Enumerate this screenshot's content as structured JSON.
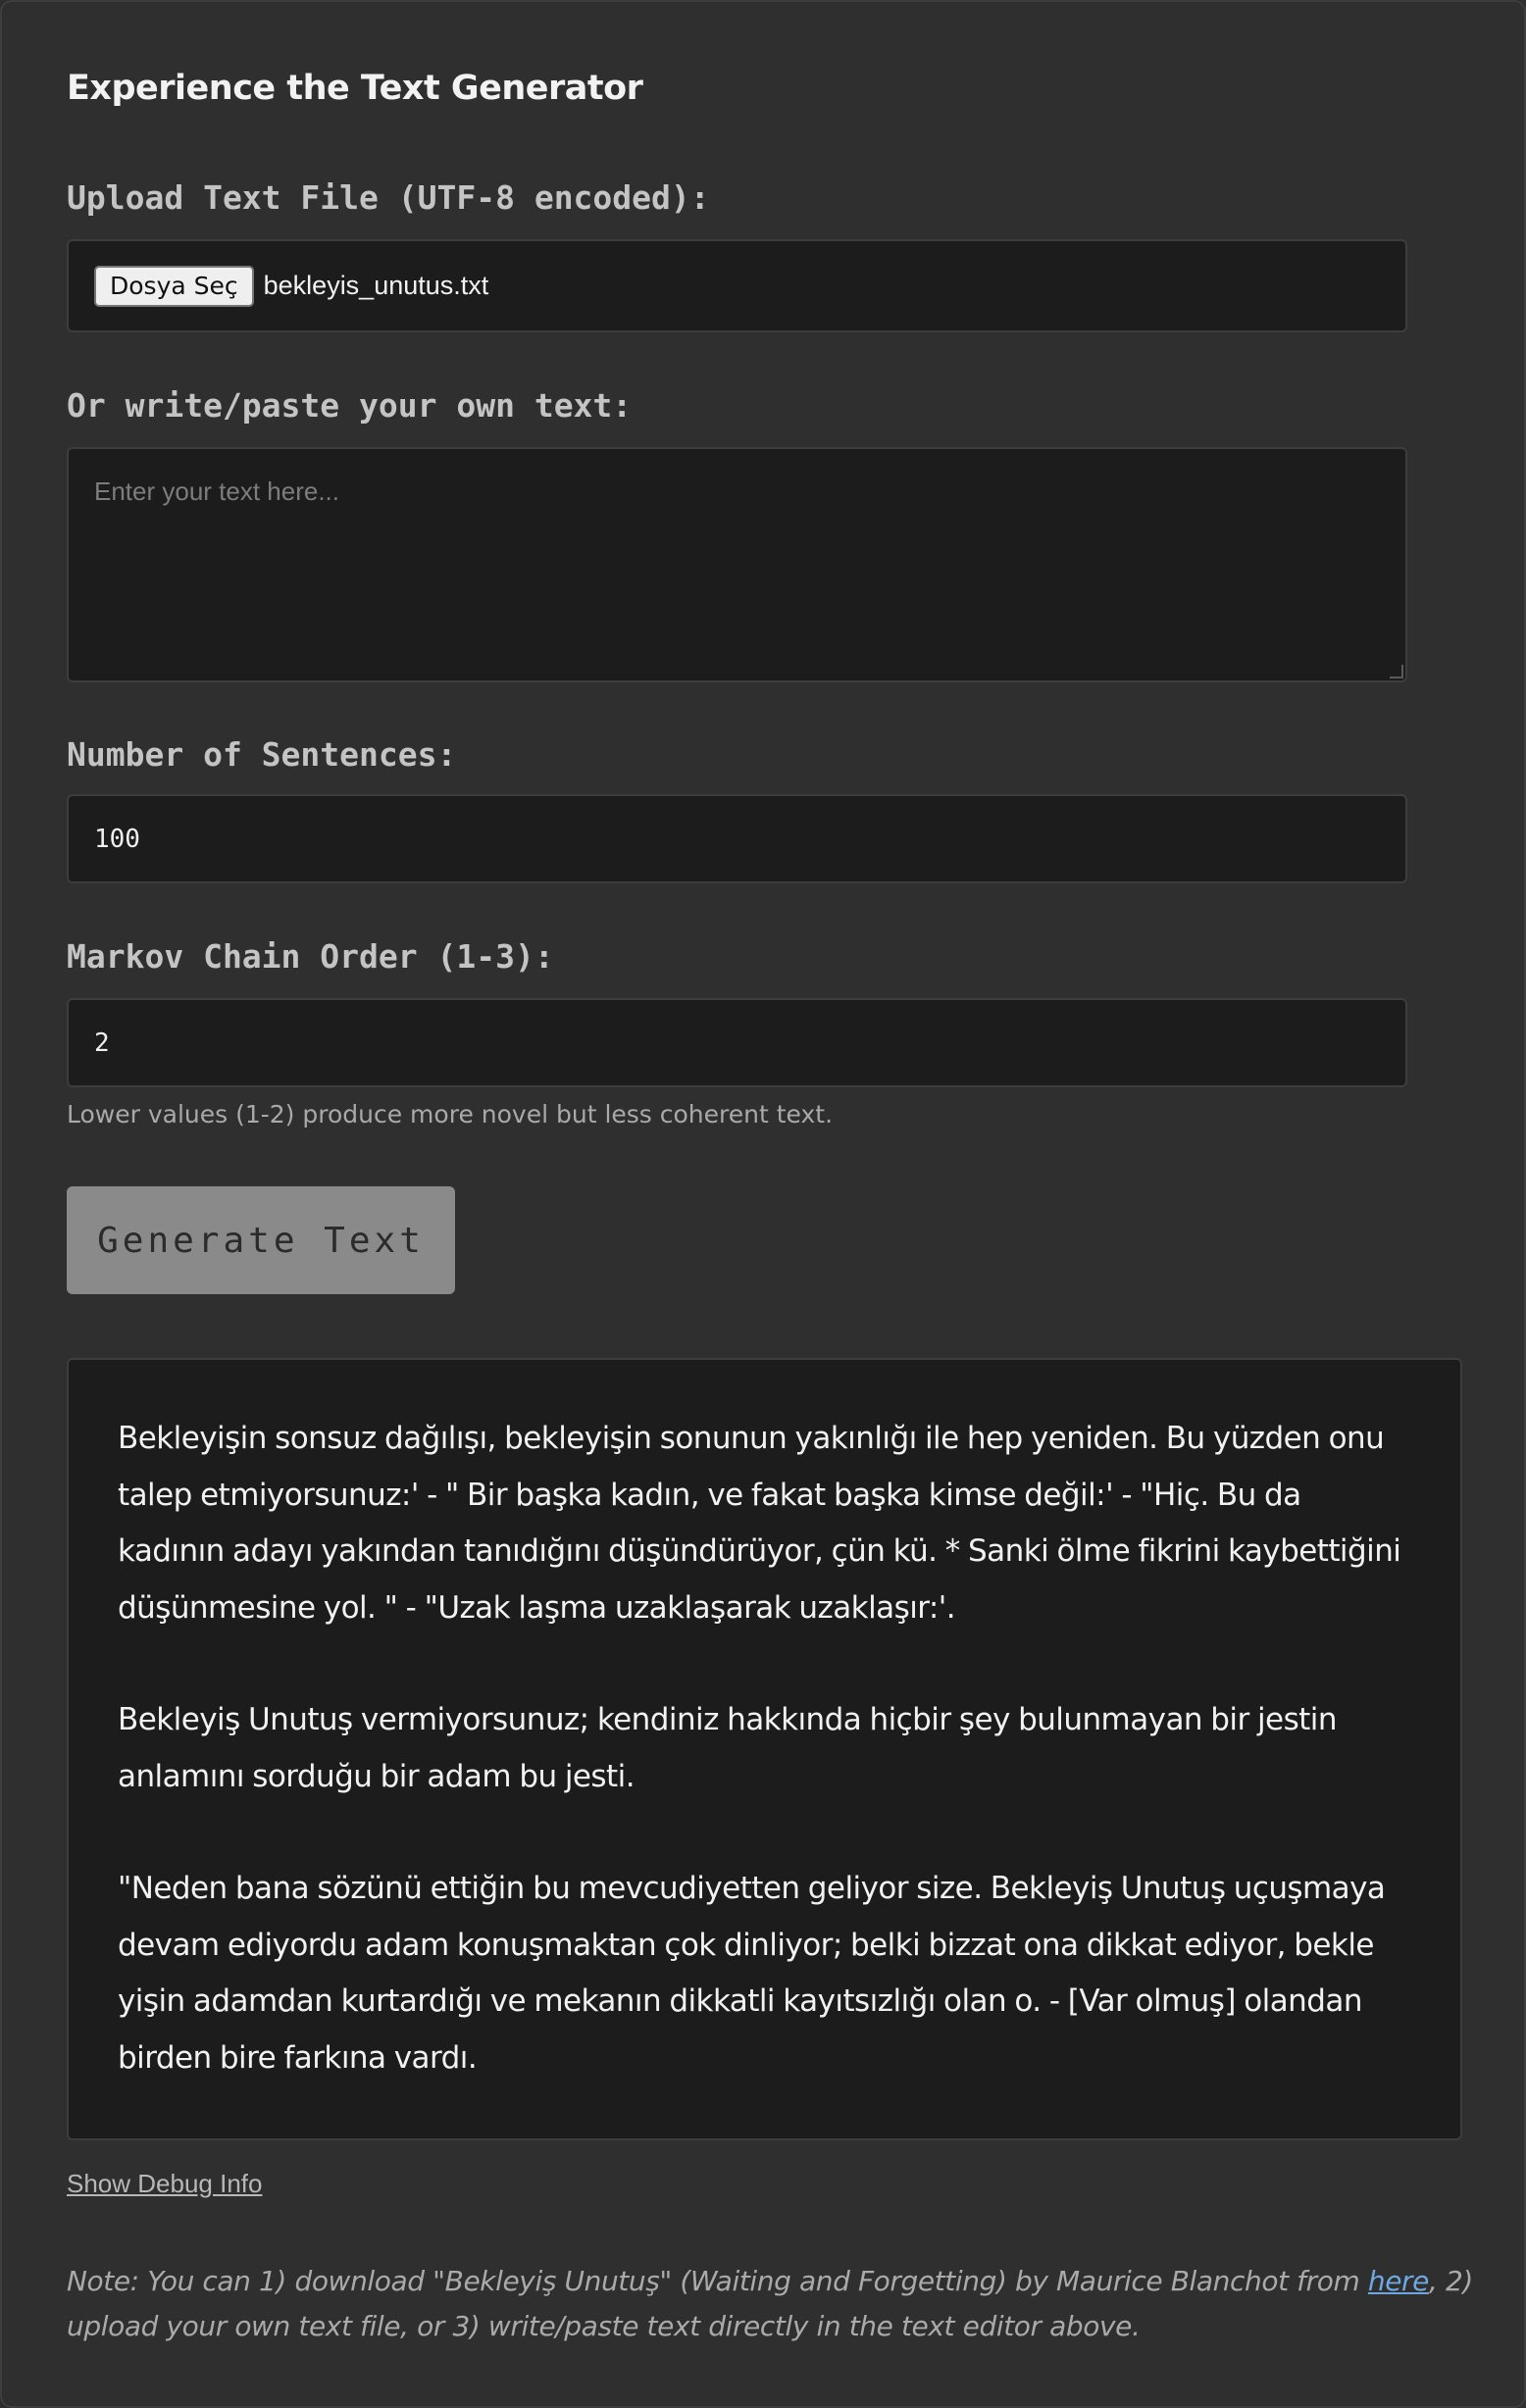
{
  "title": "Experience the Text Generator",
  "upload": {
    "label": "Upload Text File (UTF-8 encoded):",
    "button_label": "Dosya Seç",
    "file_name": "bekleyis_unutus.txt"
  },
  "text_input": {
    "label": "Or write/paste your own text:",
    "placeholder": "Enter your text here..."
  },
  "sentences": {
    "label": "Number of Sentences:",
    "value": "100"
  },
  "order": {
    "label": "Markov Chain Order (1-3):",
    "value": "2",
    "hint": "Lower values (1-2) produce more novel but less coherent text."
  },
  "generate_button": "Generate Text",
  "output": {
    "paragraphs": [
      "Bekleyişin sonsuz dağılışı, bekleyişin sonunun yakınlığı ile hep yeniden. Bu yüzden onu talep etmiyorsunuz:' - \" Bir başka kadın, ve fakat başka kimse değil:' - \"Hiç. Bu da kadının adayı yakından tanıdığını düşündürüyor, çün kü. * Sanki ölme fikrini kaybettiğini düşünmesine yol. \" - \"Uzak laşma uzaklaşarak uzaklaşır:'.",
      "Bekleyiş Unutuş vermiyorsunuz; kendiniz hakkında hiçbir şey bulunmayan bir jestin anlamını sorduğu bir adam bu jesti.",
      "\"Neden bana sözünü ettiğin bu mevcudiyetten geliyor size. Bekleyiş Unutuş uçuşmaya devam ediyordu adam konuşmaktan çok dinliyor; belki bizzat ona dikkat ediyor, bekle yişin adamdan kurtardığı ve mekanın dikkatli kayıtsızlığı olan o. - [Var olmuş] olandan birden bire farkına vardı."
    ]
  },
  "debug_link": "Show Debug Info",
  "note": {
    "before_link": "Note: You can 1) download \"Bekleyiş Unutuş\" (Waiting and Forgetting) by Maurice Blanchot from ",
    "link_text": "here",
    "after_link": ", 2) upload your own text file, or 3) write/paste text directly in the text editor above."
  }
}
